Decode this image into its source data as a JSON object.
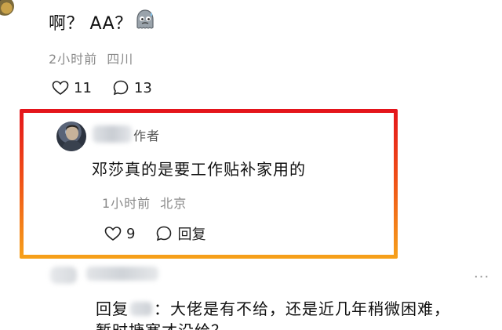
{
  "top_comment": {
    "text": "啊？ AA？",
    "time": "2小时前",
    "location": "四川",
    "likes": "11",
    "replies": "13"
  },
  "highlight_reply": {
    "author_tag": "作者",
    "text": "邓莎真的是要工作贴补家用的",
    "time": "1小时前",
    "location": "北京",
    "likes": "9",
    "reply_label": "回复"
  },
  "bottom_comment": {
    "reply_prefix": "回复",
    "text_line1": "：大佬是有不给，还是近几年稍微困难，",
    "text_line2": "暂时搪塞才没给？",
    "more_label": "···"
  },
  "colors": {
    "frame_top": "#e4141b",
    "frame_mid": "#ef4e18",
    "frame_bottom": "#f6a11a"
  }
}
